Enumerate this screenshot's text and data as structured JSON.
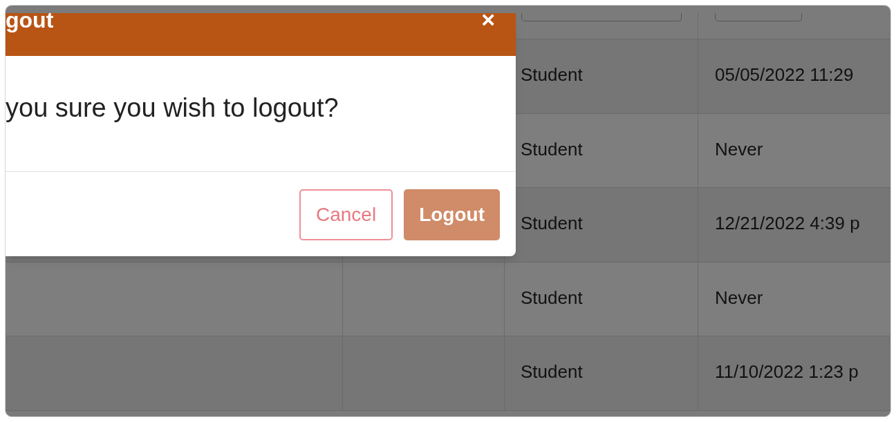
{
  "dialog": {
    "title": "gout",
    "close": "×",
    "message": "you sure you wish to logout?",
    "buttons": [
      {
        "label": "Cancel",
        "kind": "secondary"
      },
      {
        "label": "Logout",
        "kind": "primary"
      }
    ]
  },
  "table": {
    "rows": [
      {
        "role": "Student",
        "last_login": "05/05/2022 11:29"
      },
      {
        "role": "Student",
        "last_login": "Never"
      },
      {
        "role": "Student",
        "last_login": "12/21/2022 4:39 p"
      },
      {
        "role": "Student",
        "last_login": "Never"
      },
      {
        "role": "Student",
        "last_login": "11/10/2022 1:23 p"
      }
    ]
  }
}
